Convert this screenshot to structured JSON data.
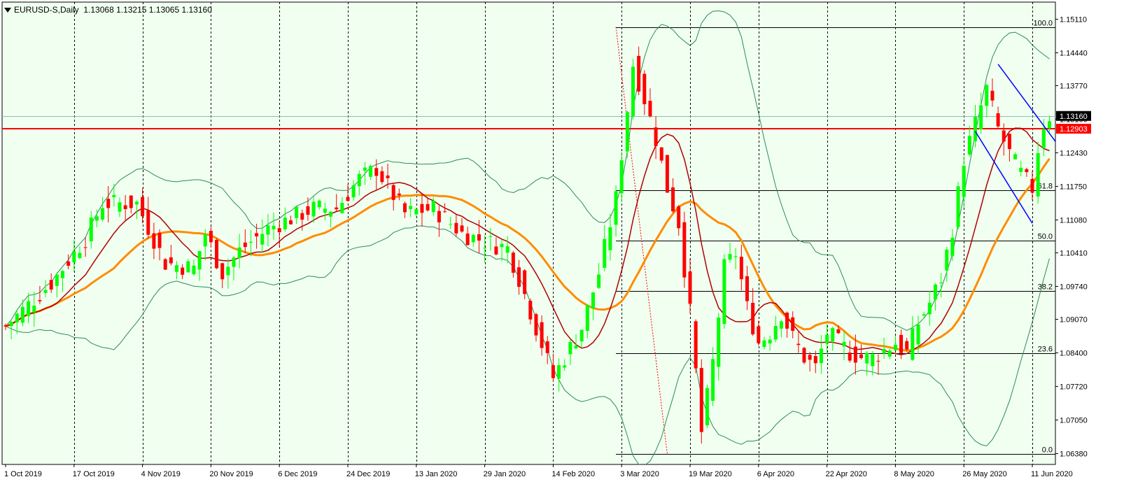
{
  "header": {
    "symbol": "EURUSD-S,Daily",
    "ohlc": "1.13068 1.13215 1.13065 1.13160"
  },
  "colors": {
    "background": "#f0fff0",
    "bull": "#00ff00",
    "bear": "#ff0000",
    "ma_fast": "#b00000",
    "ma_slow": "#ff8c00",
    "bollinger": "#2e8b57",
    "channel": "#0000ff",
    "fib": "#000000",
    "current_price_line": "#8fbcbc",
    "support_line": "#ff0000"
  },
  "chart_data": {
    "type": "candlestick",
    "instrument": "EURUSD-S",
    "timeframe": "Daily",
    "ylim": [
      1.0615,
      1.1545
    ],
    "y_ticks": [
      "1.15110",
      "1.14440",
      "1.13770",
      "1.13100",
      "1.12430",
      "1.11750",
      "1.11080",
      "1.10410",
      "1.09740",
      "1.09070",
      "1.08400",
      "1.07720",
      "1.07050",
      "1.06380"
    ],
    "x_labels": [
      "1 Oct 2019",
      "17 Oct 2019",
      "4 Nov 2019",
      "20 Nov 2019",
      "6 Dec 2019",
      "24 Dec 2019",
      "13 Jan 2020",
      "29 Jan 2020",
      "14 Feb 2020",
      "3 Mar 2020",
      "19 Mar 2020",
      "6 Apr 2020",
      "22 Apr 2020",
      "8 May 2020",
      "26 May 2020",
      "11 Jun 2020"
    ],
    "x_label_bar_index": [
      0,
      12,
      24,
      36,
      48,
      60,
      72,
      84,
      96,
      108,
      120,
      132,
      144,
      156,
      168,
      180
    ],
    "period_separator_bar_index": [
      12,
      24,
      36,
      48,
      60,
      72,
      84,
      96,
      108,
      120,
      132,
      144,
      156,
      168,
      180
    ],
    "close_anchors": [
      [
        0,
        1.0893
      ],
      [
        8,
        1.098
      ],
      [
        14,
        1.107
      ],
      [
        17,
        1.114
      ],
      [
        23,
        1.114
      ],
      [
        28,
        1.102
      ],
      [
        33,
        1.101
      ],
      [
        35,
        1.108
      ],
      [
        38,
        1.1
      ],
      [
        41,
        1.1045
      ],
      [
        46,
        1.109
      ],
      [
        54,
        1.113
      ],
      [
        58,
        1.113
      ],
      [
        62,
        1.119
      ],
      [
        65,
        1.121
      ],
      [
        70,
        1.112
      ],
      [
        75,
        1.113
      ],
      [
        80,
        1.108
      ],
      [
        85,
        1.106
      ],
      [
        88,
        1.105
      ],
      [
        90,
        1.099
      ],
      [
        96,
        1.079
      ],
      [
        98,
        1.083
      ],
      [
        101,
        1.089
      ],
      [
        104,
        1.1
      ],
      [
        107,
        1.115
      ],
      [
        110,
        1.142
      ],
      [
        112,
        1.135
      ],
      [
        114,
        1.127
      ],
      [
        116,
        1.117
      ],
      [
        118,
        1.11
      ],
      [
        120,
        1.092
      ],
      [
        122,
        1.068
      ],
      [
        124,
        1.082
      ],
      [
        126,
        1.101
      ],
      [
        128,
        1.104
      ],
      [
        130,
        1.093
      ],
      [
        132,
        1.086
      ],
      [
        134,
        1.088
      ],
      [
        136,
        1.092
      ],
      [
        138,
        1.087
      ],
      [
        140,
        1.083
      ],
      [
        142,
        1.081
      ],
      [
        144,
        1.088
      ],
      [
        146,
        1.086
      ],
      [
        148,
        1.084
      ],
      [
        150,
        1.083
      ],
      [
        152,
        1.083
      ],
      [
        156,
        1.086
      ],
      [
        158,
        1.084
      ],
      [
        160,
        1.09
      ],
      [
        162,
        1.094
      ],
      [
        164,
        1.099
      ],
      [
        166,
        1.109
      ],
      [
        168,
        1.123
      ],
      [
        170,
        1.13
      ],
      [
        172,
        1.137
      ],
      [
        174,
        1.129
      ],
      [
        176,
        1.124
      ],
      [
        178,
        1.12
      ],
      [
        180,
        1.117
      ],
      [
        181,
        1.125
      ],
      [
        182,
        1.13
      ],
      [
        183,
        1.1316
      ]
    ],
    "last_price": "1.13160",
    "horizontal_level": "1.12903",
    "fibonacci": {
      "high": 1.1495,
      "low": 1.0636,
      "levels": [
        {
          "ratio": 1.0,
          "label": "100.0"
        },
        {
          "ratio": 0.618,
          "label": "61.8"
        },
        {
          "ratio": 0.5,
          "label": "50.0"
        },
        {
          "ratio": 0.382,
          "label": "38.2"
        },
        {
          "ratio": 0.236,
          "label": "23.6"
        },
        {
          "ratio": 0.0,
          "label": "0.0"
        }
      ]
    },
    "channel": {
      "upper": [
        [
          174,
          1.142
        ],
        [
          185,
          1.125
        ]
      ],
      "lower": [
        [
          170,
          1.1285
        ],
        [
          180,
          1.11
        ]
      ]
    },
    "indicators": [
      "Moving average (fast)",
      "Moving average (slow)",
      "Bollinger Bands"
    ]
  }
}
